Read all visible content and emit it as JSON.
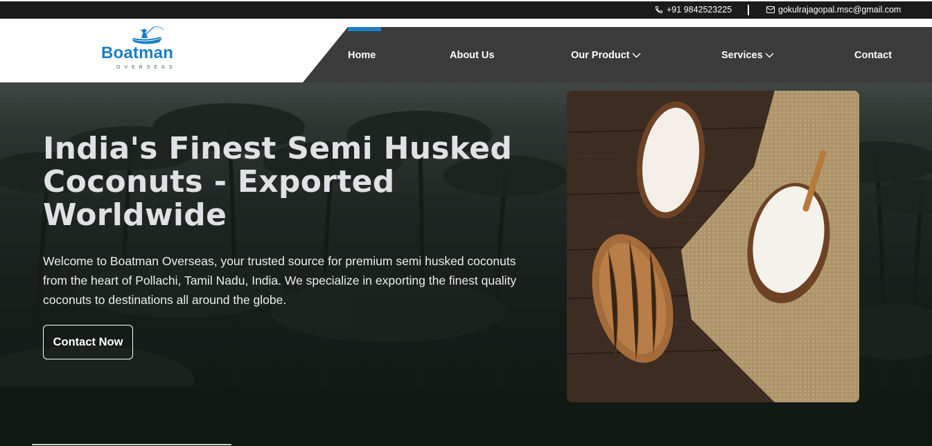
{
  "topbar": {
    "phone": "+91 9842523225",
    "email": "gokulrajagopal.msc@gmail.com"
  },
  "logo": {
    "brand": "Boatman",
    "subtitle": "OVERSEAS"
  },
  "nav": {
    "items": [
      {
        "label": "Home"
      },
      {
        "label": "About Us"
      },
      {
        "label": "Our Product"
      },
      {
        "label": "Services"
      },
      {
        "label": "Contact"
      }
    ]
  },
  "hero": {
    "headline": "India's Finest Semi Husked Coconuts - Exported Worldwide",
    "intro": "Welcome to Boatman Overseas, your trusted source for premium semi husked coconuts from the heart of Pollachi, Tamil Nadu, India. We specialize in exporting the finest quality coconuts to destinations all around the globe.",
    "cta_label": "Contact Now"
  },
  "colors": {
    "accent": "#1a7fc6",
    "nav_bg": "#3b3b3b",
    "topbar_bg": "#1b1b1b"
  }
}
